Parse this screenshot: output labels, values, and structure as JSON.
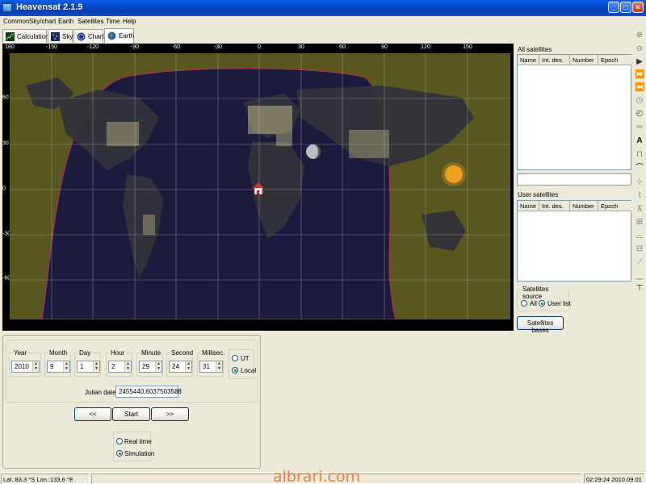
{
  "window": {
    "title": "Heavensat 2.1.9"
  },
  "menu": [
    "Common",
    "Sky/chart",
    "Earth",
    "Satellites",
    "Time",
    "Help"
  ],
  "tabs": [
    {
      "label": "Calculations",
      "icon": "calculations-icon"
    },
    {
      "label": "Sky",
      "icon": "sky-icon"
    },
    {
      "label": "Chart",
      "icon": "chart-icon"
    },
    {
      "label": "Earth",
      "icon": "earth-icon",
      "active": true
    }
  ],
  "map": {
    "longitude_labels": [
      "180",
      "-150",
      "-120",
      "-90",
      "-60",
      "-30",
      "0",
      "30",
      "60",
      "90",
      "120",
      "150"
    ],
    "latitude_labels": [
      "60",
      "30",
      "0",
      "-30",
      "-60"
    ],
    "colors": {
      "ocean_night": "#1b1b3e",
      "day_tint": "#5a5a20",
      "terminator": "#b03050",
      "sun": "#f0a020"
    }
  },
  "all_satellites": {
    "title": "All satellites",
    "columns": [
      "Name",
      "Int. des.",
      "Number",
      "Epoch"
    ]
  },
  "user_satellites": {
    "title": "User satellites",
    "columns": [
      "Name",
      "Int. des.",
      "Number",
      "Epoch"
    ]
  },
  "satellites_source": {
    "title": "Satellites source",
    "options": [
      "All",
      "User list"
    ],
    "selected": "User list"
  },
  "satellites_bases_button": "Satellites bases",
  "datetime": {
    "year": {
      "label": "Year",
      "value": "2010"
    },
    "month": {
      "label": "Month",
      "value": "9"
    },
    "day": {
      "label": "Day",
      "value": "1"
    },
    "hour": {
      "label": "Hour",
      "value": "2"
    },
    "minute": {
      "label": "Minute",
      "value": "29"
    },
    "second": {
      "label": "Second",
      "value": "24"
    },
    "millisec": {
      "label": "Millisec.",
      "value": "31"
    },
    "timezone": {
      "options": [
        "UT",
        "Local"
      ],
      "selected": "Local"
    },
    "julian_label": "Julian date:",
    "julian_value": "2455440.6037503588"
  },
  "controls": {
    "prev": "<<",
    "start": "Start",
    "next": ">>"
  },
  "mode": {
    "options": [
      "Real time",
      "Simulation"
    ],
    "selected": "Simulation"
  },
  "status": {
    "coords": "Lat.:83.3 °S Lon.:133.6 °E",
    "datetime": "02:29:24 2010.09.01"
  },
  "watermark": "albrari.com"
}
